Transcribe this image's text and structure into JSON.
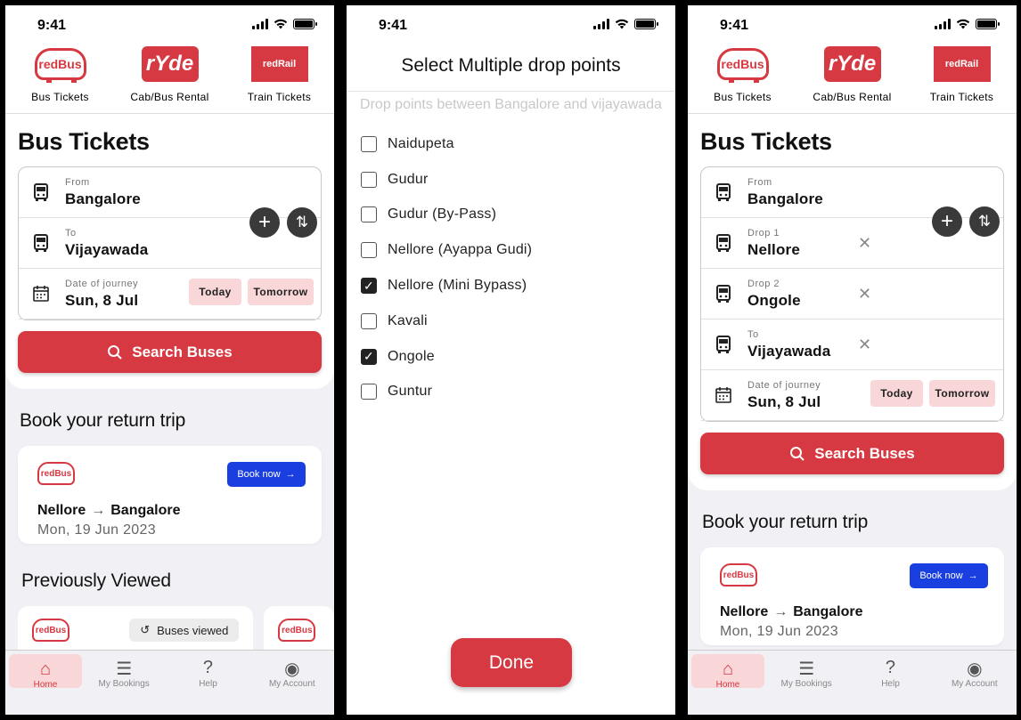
{
  "status": {
    "time": "9:41"
  },
  "brands": [
    "Bus Tickets",
    "Cab/Bus Rental",
    "Train Tickets"
  ],
  "brand_logos": [
    "redBus",
    "rYde",
    "redRail"
  ],
  "screen1": {
    "title": "Bus Tickets",
    "from_label": "From",
    "from_value": "Bangalore",
    "to_label": "To",
    "to_value": "Vijayawada",
    "date_label": "Date of journey",
    "date_value": "Sun, 8 Jul",
    "today": "Today",
    "tomorrow": "Tomorrow",
    "search": "Search Buses",
    "return_heading": "Book your return trip",
    "return_logo": "redBus",
    "book_now": "Book now",
    "return_from": "Nellore",
    "return_to": "Bangalore",
    "return_date": "Mon, 19 Jun 2023",
    "prev_heading": "Previously Viewed",
    "buses_viewed": "Buses viewed"
  },
  "screen2": {
    "title": "Select Multiple drop points",
    "subtitle": "Drop points between Bangalore and vijayawada",
    "options": [
      {
        "label": "Naidupeta",
        "checked": false
      },
      {
        "label": "Gudur",
        "checked": false
      },
      {
        "label": "Gudur (By-Pass)",
        "checked": false
      },
      {
        "label": "Nellore (Ayappa Gudi)",
        "checked": false
      },
      {
        "label": "Nellore (Mini Bypass)",
        "checked": true
      },
      {
        "label": "Kavali",
        "checked": false
      },
      {
        "label": "Ongole",
        "checked": true
      },
      {
        "label": "Guntur",
        "checked": false
      }
    ],
    "done": "Done"
  },
  "screen3": {
    "title": "Bus Tickets",
    "from_label": "From",
    "from_value": "Bangalore",
    "drop1_label": "Drop 1",
    "drop1_value": "Nellore",
    "drop2_label": "Drop 2",
    "drop2_value": "Ongole",
    "to_label": "To",
    "to_value": "Vijayawada",
    "date_label": "Date of journey",
    "date_value": "Sun, 8 Jul",
    "today": "Today",
    "tomorrow": "Tomorrow",
    "search": "Search Buses",
    "return_heading": "Book your return trip",
    "book_now": "Book now",
    "return_from": "Nellore",
    "return_to": "Bangalore",
    "return_date": "Mon, 19 Jun 2023"
  },
  "tabs": [
    "Home",
    "My Bookings",
    "Help",
    "My Account"
  ],
  "colors": {
    "brand_red": "#d63941",
    "book_blue": "#1a3fe0",
    "chip_pink": "#f9d6d8"
  }
}
